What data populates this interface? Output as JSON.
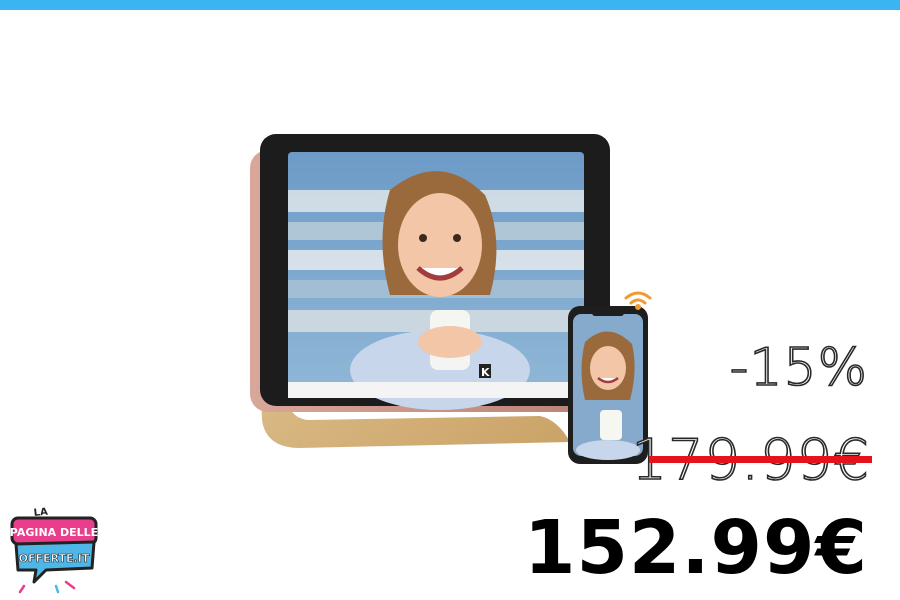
{
  "promo": {
    "discount": "-15%",
    "old_price": "179.99€",
    "new_price": "152.99€"
  },
  "logo": {
    "line1": "LA",
    "line2": "PAGINA DELLE",
    "line3": "OFFERTE.IT"
  },
  "product": {
    "brand_mark": "K"
  },
  "colors": {
    "top_bar": "#3bb4f2",
    "strike": "#e5141c",
    "logo_pink": "#e83e8c",
    "logo_blue": "#4fb6e8"
  }
}
